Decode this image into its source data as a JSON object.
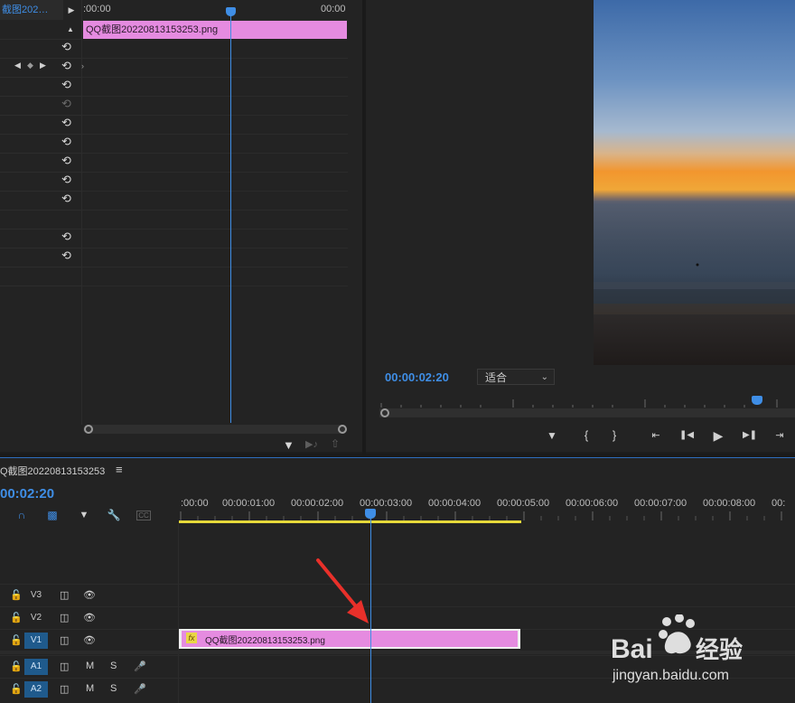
{
  "effect_controls": {
    "clip_tab": "截图202…",
    "ruler_start": ":00:00",
    "ruler_end": "00:00",
    "clip_name": "QQ截图20220813153253.png"
  },
  "program_monitor": {
    "timecode": "00:00:02:20",
    "fit_label": "适合"
  },
  "timeline": {
    "sequence_title": "Q截图20220813153253",
    "timecode": "00:02:20",
    "ruler_labels": [
      ":00:00",
      "00:00:01:00",
      "00:00:02:00",
      "00:00:03:00",
      "00:00:04:00",
      "00:00:05:00",
      "00:00:06:00",
      "00:00:07:00",
      "00:00:08:00",
      "00:"
    ],
    "tracks": {
      "v3": "V3",
      "v2": "V2",
      "v1": "V1",
      "a1": "A1",
      "a2": "A2",
      "mute": "M",
      "solo": "S"
    },
    "clip_name": "QQ截图20220813153253.png",
    "clip_fx": "fx"
  },
  "watermark": {
    "logo_text": "Bai  经验",
    "url": "jingyan.baidu.com"
  },
  "colors": {
    "accent": "#3f8ee6",
    "clip": "#e58be0",
    "workarea": "#e6d93a",
    "track_active": "#1f5a8c"
  }
}
